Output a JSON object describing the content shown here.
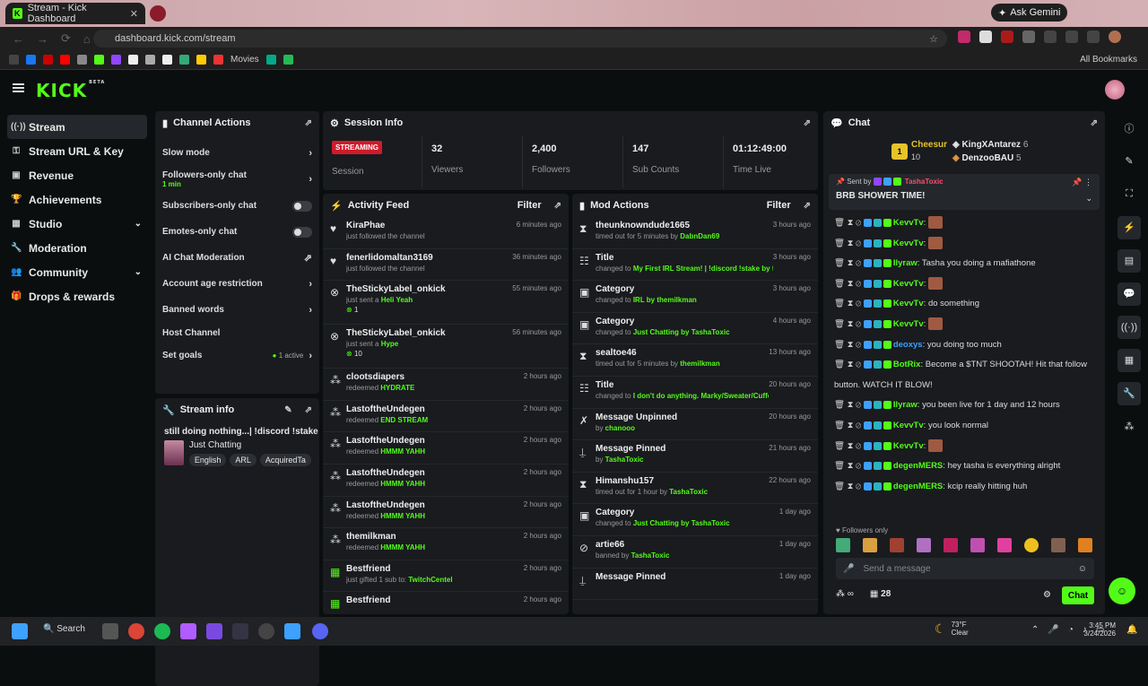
{
  "browser": {
    "tab_title": "Stream - Kick Dashboard",
    "url": "dashboard.kick.com/stream",
    "gemini": "Ask Gemini",
    "bookmarks_movies": "Movies",
    "all_bookmarks": "All Bookmarks"
  },
  "logo": "KICK",
  "logo_beta": "BETA",
  "sidebar": [
    {
      "label": "Stream",
      "icon": "broadcast-icon"
    },
    {
      "label": "Stream URL & Key",
      "icon": "key-icon"
    },
    {
      "label": "Revenue",
      "icon": "money-icon"
    },
    {
      "label": "Achievements",
      "icon": "trophy-icon"
    },
    {
      "label": "Studio",
      "icon": "studio-icon"
    },
    {
      "label": "Moderation",
      "icon": "wrench-icon"
    },
    {
      "label": "Community",
      "icon": "people-icon"
    },
    {
      "label": "Drops & rewards",
      "icon": "gift-icon"
    }
  ],
  "channel_actions": {
    "title": "Channel Actions",
    "slow": "Slow mode",
    "followers": "Followers-only chat",
    "followers_sub": "1 min",
    "subs": "Subscribers-only chat",
    "emotes": "Emotes-only chat",
    "ai": "AI Chat Moderation",
    "age": "Account age restriction",
    "banned": "Banned words",
    "host": "Host Channel",
    "goals": "Set goals",
    "goals_active": "1 active"
  },
  "stream_info": {
    "title": "Stream info",
    "stream_title": "still doing nothing...| !discord !stake",
    "category": "Just Chatting",
    "tags": [
      "English",
      "ARL",
      "AcquiredTa"
    ]
  },
  "session": {
    "title": "Session Info",
    "status": "STREAMING",
    "status_label": "Session",
    "viewers": "32",
    "viewers_label": "Viewers",
    "followers": "2,400",
    "followers_label": "Followers",
    "subs": "147",
    "subs_label": "Sub Counts",
    "time": "01:12:49:00",
    "time_label": "Time Live"
  },
  "activity": {
    "title": "Activity Feed",
    "filter": "Filter",
    "items": [
      {
        "name": "KiraPhae",
        "desc": "just followed the channel",
        "hl": "",
        "time": "6 minutes ago",
        "icon": "heart-icon"
      },
      {
        "name": "fenerlidomaltan3169",
        "desc": "just followed the channel",
        "hl": "",
        "time": "36 minutes ago",
        "icon": "heart-icon"
      },
      {
        "name": "TheStickyLabel_onkick",
        "desc": "just sent a ",
        "hl": "Heli Yeah",
        "time": "55 minutes ago",
        "icon": "kick-icon",
        "amount": "1"
      },
      {
        "name": "TheStickyLabel_onkick",
        "desc": "just sent a ",
        "hl": "Hype",
        "time": "56 minutes ago",
        "icon": "kick-icon",
        "amount": "10"
      },
      {
        "name": "clootsdiapers",
        "desc": "redeemed ",
        "hl": "HYDRATE",
        "time": "2 hours ago",
        "icon": "points-icon"
      },
      {
        "name": "LastoftheUndegen",
        "desc": "redeemed ",
        "hl": "END STREAM",
        "time": "2 hours ago",
        "icon": "points-icon"
      },
      {
        "name": "LastoftheUndegen",
        "desc": "redeemed ",
        "hl": "HMMM YAHH",
        "time": "2 hours ago",
        "icon": "points-icon"
      },
      {
        "name": "LastoftheUndegen",
        "desc": "redeemed ",
        "hl": "HMMM YAHH",
        "time": "2 hours ago",
        "icon": "points-icon"
      },
      {
        "name": "LastoftheUndegen",
        "desc": "redeemed ",
        "hl": "HMMM YAHH",
        "time": "2 hours ago",
        "icon": "points-icon"
      },
      {
        "name": "themilkman",
        "desc": "redeemed ",
        "hl": "HMMM YAHH",
        "time": "2 hours ago",
        "icon": "points-icon"
      },
      {
        "name": "Bestfriend",
        "desc": "just gifted 1 sub to: ",
        "hl": "TwitchCentel",
        "time": "2 hours ago",
        "icon": "gift-icon"
      },
      {
        "name": "Bestfriend",
        "desc": "",
        "hl": "",
        "time": "2 hours ago",
        "icon": "gift-icon"
      }
    ]
  },
  "mod": {
    "title": "Mod Actions",
    "filter": "Filter",
    "items": [
      {
        "name": "theunknowndude1665",
        "desc": "timed out for 5 minutes by ",
        "hl": "DabnDan69",
        "time": "3 hours ago",
        "icon": "hourglass-icon"
      },
      {
        "name": "Title",
        "desc": "changed to ",
        "hl": "My First IRL Stream! | !discord !stake by themilkman",
        "time": "3 hours ago",
        "icon": "title-icon"
      },
      {
        "name": "Category",
        "desc": "changed to ",
        "hl": "IRL by themilkman",
        "time": "3 hours ago",
        "icon": "category-icon"
      },
      {
        "name": "Category",
        "desc": "changed to ",
        "hl": "Just Chatting by TashaToxic",
        "time": "4 hours ago",
        "icon": "category-icon"
      },
      {
        "name": "sealtoe46",
        "desc": "timed out for 5 minutes by ",
        "hl": "themilkman",
        "time": "13 hours ago",
        "icon": "hourglass-icon"
      },
      {
        "name": "Title",
        "desc": "changed to ",
        "hl": "I don't do anything. Marky/Sweater/Cuffem just like me! | !discord !stake by chanooo",
        "time": "20 hours ago",
        "icon": "title-icon"
      },
      {
        "name": "Message Unpinned",
        "desc": "by ",
        "hl": "chanooo",
        "time": "20 hours ago",
        "icon": "unpin-icon"
      },
      {
        "name": "Message Pinned",
        "desc": "by ",
        "hl": "TashaToxic",
        "time": "21 hours ago",
        "icon": "pin-icon"
      },
      {
        "name": "Himanshu157",
        "desc": "timed out for 1 hour by ",
        "hl": "TashaToxic",
        "time": "22 hours ago",
        "icon": "hourglass-icon"
      },
      {
        "name": "Category",
        "desc": "changed to ",
        "hl": "Just Chatting by TashaToxic",
        "time": "1 day ago",
        "icon": "category-icon"
      },
      {
        "name": "artie66",
        "desc": "banned by ",
        "hl": "TashaToxic",
        "time": "1 day ago",
        "icon": "ban-icon"
      },
      {
        "name": "Message Pinned",
        "desc": "",
        "hl": "",
        "time": "1 day ago",
        "icon": "pin-icon"
      }
    ]
  },
  "chat": {
    "title": "Chat",
    "top1": "Cheesur",
    "top1_n": "10",
    "top2": "KingXAntarez",
    "top2_n": "6",
    "top3": "DenzooBAU",
    "top3_n": "5",
    "pinned_by": "Sent by",
    "pinned_user": "TashaToxic",
    "pinned_msg": "BRB SHOWER TIME!",
    "lines": [
      {
        "user": "KevvTv",
        "msg": "",
        "color": "#53fc18"
      },
      {
        "user": "KevvTv",
        "msg": "",
        "color": "#53fc18"
      },
      {
        "user": "Ilyraw",
        "msg": "Tasha you doing a mafiathone",
        "color": "#53fc18"
      },
      {
        "user": "KevvTv",
        "msg": "",
        "color": "#53fc18"
      },
      {
        "user": "KevvTv",
        "msg": "do something",
        "color": "#53fc18"
      },
      {
        "user": "KevvTv",
        "msg": "",
        "color": "#53fc18"
      },
      {
        "user": "deoxys",
        "msg": "you doing too much",
        "color": "#3ea0ff"
      },
      {
        "user": "BotRix",
        "msg": "Become a $TNT SHOOTAH! Hit that follow",
        "color": "#53fc18"
      },
      {
        "user": "",
        "msg": "button. WATCH IT BLOW!",
        "color": "#53fc18"
      },
      {
        "user": "Ilyraw",
        "msg": "you been live for 1 day and 12 hours",
        "color": "#53fc18"
      },
      {
        "user": "KevvTv",
        "msg": "you look normal",
        "color": "#53fc18"
      },
      {
        "user": "KevvTv",
        "msg": "",
        "color": "#53fc18"
      },
      {
        "user": "degenMERS",
        "msg": "hey tasha is everything alright",
        "color": "#53fc18"
      },
      {
        "user": "degenMERS",
        "msg": "kcip really hitting huh",
        "color": "#53fc18"
      }
    ],
    "followers_only": "Followers only",
    "placeholder": "Send a message",
    "count": "28",
    "send": "Chat"
  },
  "taskbar": {
    "search": "Search",
    "weather": "73°F",
    "weather_desc": "Clear",
    "time": "3:45 PM",
    "date": "3/24/2026"
  }
}
